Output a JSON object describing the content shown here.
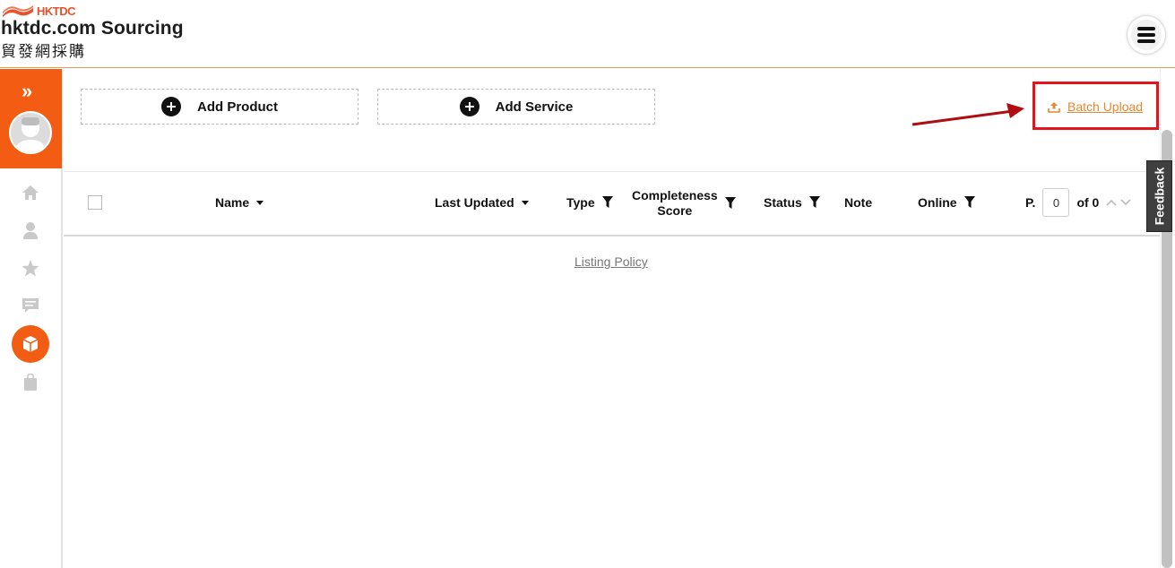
{
  "header": {
    "logo_small": "HKTDC",
    "brand_title": "hktdc.com Sourcing",
    "brand_subtitle": "貿發網採購",
    "menu_icon": "hamburger-menu-icon"
  },
  "sidebar": {
    "expand_icon": "double-chevron-right-icon",
    "items": [
      {
        "icon": "home-icon"
      },
      {
        "icon": "user-icon"
      },
      {
        "icon": "star-icon"
      },
      {
        "icon": "message-icon"
      },
      {
        "icon": "box-icon",
        "active": true
      },
      {
        "icon": "bag-icon"
      }
    ],
    "accent_color": "#f35d13"
  },
  "actions": {
    "add_product": "Add Product",
    "add_service": "Add Service",
    "batch_upload": "Batch Upload"
  },
  "table": {
    "columns": {
      "name": "Name",
      "last_updated": "Last Updated",
      "type": "Type",
      "completeness_line1": "Completeness",
      "completeness_line2": "Score",
      "status": "Status",
      "note": "Note",
      "online": "Online"
    },
    "pagination": {
      "label": "P.",
      "current": "0",
      "of_label": "of 0"
    }
  },
  "footer": {
    "listing_policy": "Listing Policy"
  },
  "feedback_label": "Feedback"
}
